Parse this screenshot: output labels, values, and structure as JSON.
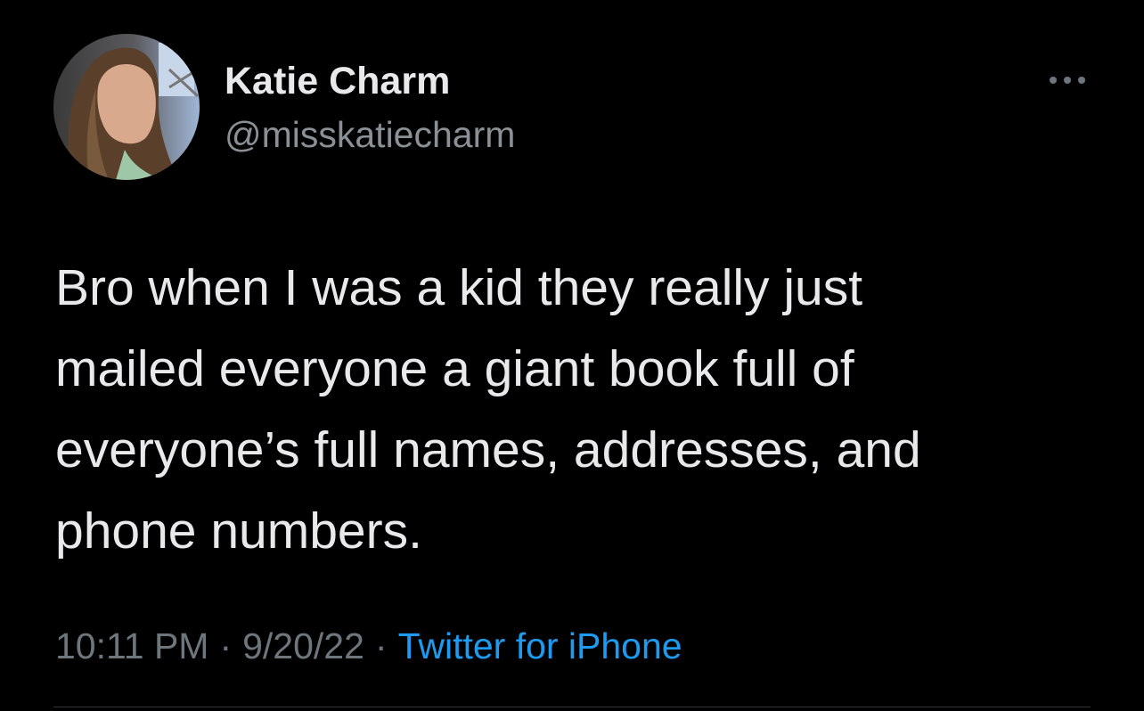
{
  "author": {
    "display_name": "Katie Charm",
    "handle": "@misskatiecharm",
    "avatar_icon": "profile-photo"
  },
  "tweet": {
    "text_lines": [
      "Bro when I was a kid they really just",
      "mailed everyone a giant book full of",
      "everyone’s full names, addresses, and",
      "phone numbers."
    ],
    "time": "10:11 PM",
    "date": "9/20/22",
    "separator": "·",
    "source": "Twitter for iPhone"
  },
  "icons": {
    "more": "more-options-icon"
  },
  "colors": {
    "background": "#000000",
    "text": "#e7e9ea",
    "secondary_text": "#6e767d",
    "link": "#1d9bf0"
  }
}
